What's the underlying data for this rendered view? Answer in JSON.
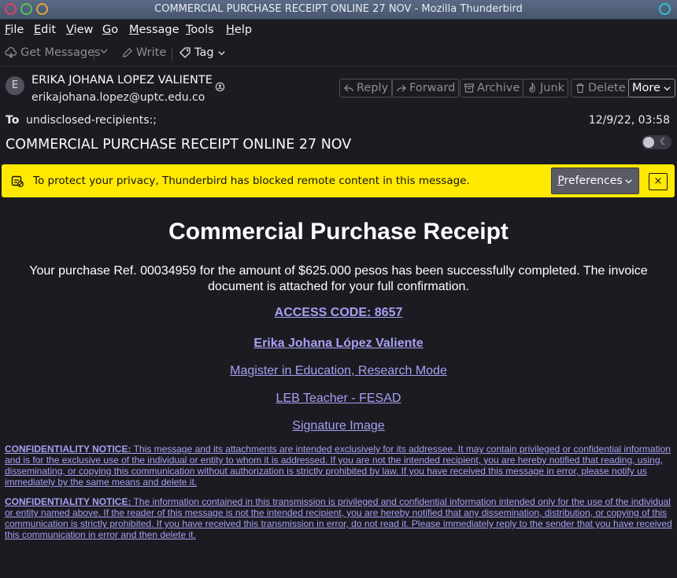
{
  "window": {
    "title": "COMMERCIAL PURCHASE RECEIPT ONLINE 27 NOV - Mozilla Thunderbird"
  },
  "menu": {
    "items": [
      {
        "first": "F",
        "rest": "ile"
      },
      {
        "first": "E",
        "rest": "dit"
      },
      {
        "first": "V",
        "rest": "iew"
      },
      {
        "first": "G",
        "rest": "o"
      },
      {
        "first": "M",
        "rest": "essage"
      },
      {
        "first": "T",
        "rest": "ools"
      },
      {
        "first": "H",
        "rest": "elp"
      }
    ]
  },
  "toolbar": {
    "get_messages": "Get Messages",
    "write": "Write",
    "tag": "Tag"
  },
  "header": {
    "avatar_letter": "E",
    "from_name": "ERIKA JOHANA LOPEZ VALIENTE",
    "from_email": "erikajohana.lopez@uptc.edu.co",
    "buttons": {
      "reply": "Reply",
      "forward": "Forward",
      "archive": "Archive",
      "junk": "Junk",
      "delete": "Delete",
      "more": "More"
    },
    "to_label": "To",
    "to_value": "undisclosed-recipients:;",
    "date": "12/9/22, 03:58",
    "subject": "COMMERCIAL PURCHASE RECEIPT ONLINE 27 NOV"
  },
  "notice": {
    "text": "To protect your privacy, Thunderbird has blocked remote content in this message.",
    "preferences_first": "P",
    "preferences_rest": "references",
    "close": "×",
    "bg_color": "#ffe900"
  },
  "message": {
    "title": "Commercial Purchase Receipt",
    "paragraph": "Your purchase Ref. 00034959 for the amount of $625.000 pesos has been successfully completed. The invoice document is attached for your full confirmation.",
    "access_code": "ACCESS CODE: 8657",
    "signer_name": "Erika Johana López Valiente",
    "signer_title": "Magister in Education, Research Mode",
    "signer_role": "LEB Teacher - FESAD",
    "signature_image": "Signature Image",
    "notice1_label": "CONFIDENTIALITY NOTICE:",
    "notice1_text": " This message and its attachments are intended exclusively for its addressee. It may contain privileged or confidential information and is for the exclusive use of the individual or entity to whom it is addressed. If you are not the intended recipient, you are hereby notified that reading, using, disseminating, or copying this communication without authorization is strictly prohibited by law. If you have received this message in error, please notify us immediately by the same means and delete it.",
    "notice2_label": "CONFIDENTIALITY NOTICE:",
    "notice2_text": " The information contained in this transmission is privileged and confidential information intended only for the use of the individual or entity named above. If the reader of this message is not the intended recipient, you are hereby notified that any dissemination, distribution, or copying of this communication is strictly prohibited. If you have received this transmission in error, do not read it. Please immediately reply to the sender that you have received this communication in error and then delete it.",
    "link_color": "#a6a1f2"
  }
}
